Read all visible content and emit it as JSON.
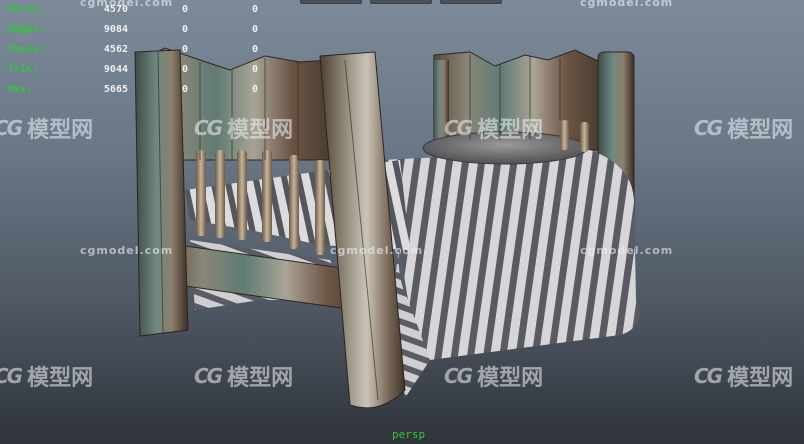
{
  "hud": {
    "rows": [
      {
        "label": "Verts:",
        "v1": "4570",
        "v2": "0",
        "v3": "0"
      },
      {
        "label": "Edges:",
        "v1": "9084",
        "v2": "0",
        "v3": "0"
      },
      {
        "label": "Faces:",
        "v1": "4562",
        "v2": "0",
        "v3": "0"
      },
      {
        "label": "Tris:",
        "v1": "9044",
        "v2": "0",
        "v3": "0"
      },
      {
        "label": "UVs:",
        "v1": "5665",
        "v2": "0",
        "v3": "0"
      }
    ]
  },
  "camera_label": "persp",
  "watermark": {
    "cn_text": "模型网",
    "logo_text": "CG",
    "url_text": "cgmodel.com"
  },
  "colors": {
    "hud_label": "#2fc83a",
    "hud_value": "#f0f0f0",
    "wood_light": "#9a9585",
    "wood_dark": "#4a3c30",
    "wood_teal": "#5e7f7a",
    "stripe_light": "#d8d8d8",
    "stripe_dark": "#55555c"
  }
}
